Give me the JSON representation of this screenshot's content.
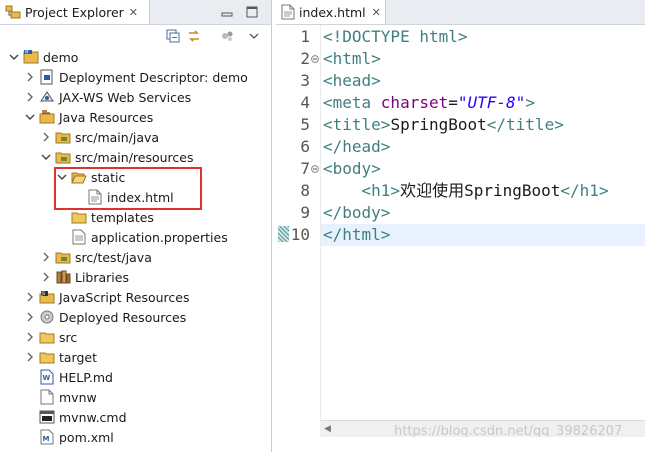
{
  "explorer": {
    "tab_label": "Project Explorer",
    "tab_close": "✕",
    "tree": [
      {
        "label": "demo",
        "indent": 0,
        "icon": "project-icon",
        "chev": "down"
      },
      {
        "label": "Deployment Descriptor: demo",
        "indent": 1,
        "icon": "deployment-descriptor-icon",
        "chev": "right"
      },
      {
        "label": "JAX-WS Web Services",
        "indent": 1,
        "icon": "web-services-icon",
        "chev": "right"
      },
      {
        "label": "Java Resources",
        "indent": 1,
        "icon": "java-resources-icon",
        "chev": "down"
      },
      {
        "label": "src/main/java",
        "indent": 2,
        "icon": "source-folder-icon",
        "chev": "right"
      },
      {
        "label": "src/main/resources",
        "indent": 2,
        "icon": "source-folder-icon",
        "chev": "down"
      },
      {
        "label": "static",
        "indent": 3,
        "icon": "folder-open-icon",
        "chev": "down"
      },
      {
        "label": "index.html",
        "indent": 4,
        "icon": "html-file-icon",
        "chev": "none"
      },
      {
        "label": "templates",
        "indent": 3,
        "icon": "folder-icon",
        "chev": "none"
      },
      {
        "label": "application.properties",
        "indent": 3,
        "icon": "properties-file-icon",
        "chev": "none"
      },
      {
        "label": "src/test/java",
        "indent": 2,
        "icon": "source-folder-icon",
        "chev": "right"
      },
      {
        "label": "Libraries",
        "indent": 2,
        "icon": "libraries-icon",
        "chev": "right"
      },
      {
        "label": "JavaScript Resources",
        "indent": 1,
        "icon": "javascript-resources-icon",
        "chev": "right"
      },
      {
        "label": "Deployed Resources",
        "indent": 1,
        "icon": "deployed-resources-icon",
        "chev": "right"
      },
      {
        "label": "src",
        "indent": 1,
        "icon": "folder-icon",
        "chev": "right"
      },
      {
        "label": "target",
        "indent": 1,
        "icon": "folder-icon",
        "chev": "right"
      },
      {
        "label": "HELP.md",
        "indent": 1,
        "icon": "markdown-file-icon",
        "chev": "none"
      },
      {
        "label": "mvnw",
        "indent": 1,
        "icon": "file-icon",
        "chev": "none"
      },
      {
        "label": "mvnw.cmd",
        "indent": 1,
        "icon": "cmd-file-icon",
        "chev": "none"
      },
      {
        "label": "pom.xml",
        "indent": 1,
        "icon": "xml-file-icon",
        "chev": "none"
      }
    ]
  },
  "editor": {
    "tab_label": "index.html",
    "tab_close": "✕",
    "line_numbers": [
      "1",
      "2",
      "3",
      "4",
      "5",
      "6",
      "7",
      "8",
      "9",
      "10"
    ],
    "lines": [
      {
        "parts": [
          [
            "t",
            "<!DOCTYPE html>"
          ]
        ]
      },
      {
        "parts": [
          [
            "t",
            "<html>"
          ]
        ],
        "fold": true
      },
      {
        "parts": [
          [
            "t",
            "<head>"
          ]
        ]
      },
      {
        "parts": [
          [
            "t",
            "<meta "
          ],
          [
            "a",
            "charset"
          ],
          [
            "x",
            "="
          ],
          [
            "v",
            "\"UTF-8\""
          ],
          [
            "t",
            ">"
          ]
        ]
      },
      {
        "parts": [
          [
            "t",
            "<title>"
          ],
          [
            "x",
            "SpringBoot"
          ],
          [
            "t",
            "</title>"
          ]
        ]
      },
      {
        "parts": [
          [
            "t",
            "</head>"
          ]
        ]
      },
      {
        "parts": [
          [
            "t",
            "<body>"
          ]
        ],
        "fold": true
      },
      {
        "parts": [
          [
            "x",
            "    "
          ],
          [
            "t",
            "<h1>"
          ],
          [
            "x",
            "欢迎使用SpringBoot"
          ],
          [
            "t",
            "</h1>"
          ]
        ]
      },
      {
        "parts": [
          [
            "t",
            "</body>"
          ]
        ]
      },
      {
        "parts": [
          [
            "t",
            "</html>"
          ]
        ]
      }
    ],
    "watermark": "https://blog.csdn.net/qq_39826207"
  },
  "colors": {
    "tag": "#3f7f7f",
    "attribute": "#7f007f",
    "value": "#2a00ff",
    "highlight_box": "#e03030"
  }
}
